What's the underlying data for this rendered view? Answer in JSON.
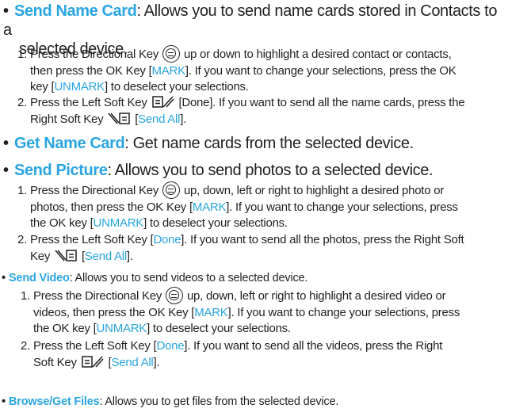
{
  "send_name_card": {
    "bullet": "•",
    "term": "Send Name Card",
    "desc_1": ": Allows you to send name cards stored in Contacts to a",
    "desc_2": "selected device.",
    "step1": {
      "num": "1.",
      "a": "Press the Directional Key",
      "b": "up or down to highlight a desired contact or contacts,",
      "l2a": "then press the OK Key [",
      "mark": "MARK",
      "l2b": "]. If you want to change your selections, press the OK",
      "l3a": "key [",
      "unmark": "UNMARK",
      "l3b": "] to deselect your selections."
    },
    "step2": {
      "num": "2.",
      "a": "Press the Left Soft Key",
      "b": "[Done]. If you want to send all the name cards, press the",
      "l2a": "Right Soft Key",
      "l2b": "[",
      "send_all": "Send All",
      "l2c": "]."
    }
  },
  "get_name_card": {
    "bullet": "•",
    "term": "Get Name Card",
    "desc": ": Get name cards from the selected device."
  },
  "send_picture": {
    "bullet": "•",
    "term": "Send Picture",
    "desc": ": Allows you to send photos to a selected device.",
    "step1": {
      "num": "1.",
      "a": "Press the Directional Key",
      "b": "up, down, left or right to highlight a desired photo or",
      "l2a": "photos, then press the OK Key [",
      "mark": "MARK",
      "l2b": "]. If you want to change your selections, press",
      "l3a": "the OK key [",
      "unmark": "UNMARK",
      "l3b": "] to deselect your selections."
    },
    "step2": {
      "num": "2.",
      "a": "Press the Left Soft Key [",
      "done": "Done",
      "b": "]. If you want to send all the photos, press the Right Soft",
      "l2a": "Key",
      "l2b": "[",
      "send_all": "Send All",
      "l2c": "]."
    }
  },
  "send_video": {
    "bullet": "•",
    "term": "Send Video",
    "desc": ": Allows you to send videos to a selected device.",
    "step1": {
      "num": "1.",
      "a": "Press the Directional Key",
      "b": "up, down, left or right to highlight a desired video or",
      "l2a": "videos, then press the OK Key [",
      "mark": "MARK",
      "l2b": "]. If you want to change your selections, press",
      "l3a": "the OK key [",
      "unmark": "UNMARK",
      "l3b": "] to deselect your selections."
    },
    "step2": {
      "num": "2.",
      "a": "Press the Left Soft Key [",
      "done": "Done",
      "b": "]. If you want to send all the videos, press the Right",
      "l2a": "Soft Key",
      "l2b": "[",
      "send_all": "Send All",
      "l2c": "]."
    }
  },
  "browse_get_files": {
    "bullet": "•",
    "term": "Browse/Get Files",
    "desc": ": Allows you to get files from the selected device."
  },
  "colors": {
    "accent": "#2aa5e0",
    "text": "#231f20"
  },
  "icons": [
    "directional-key-icon",
    "left-soft-key-icon",
    "right-soft-key-icon"
  ]
}
